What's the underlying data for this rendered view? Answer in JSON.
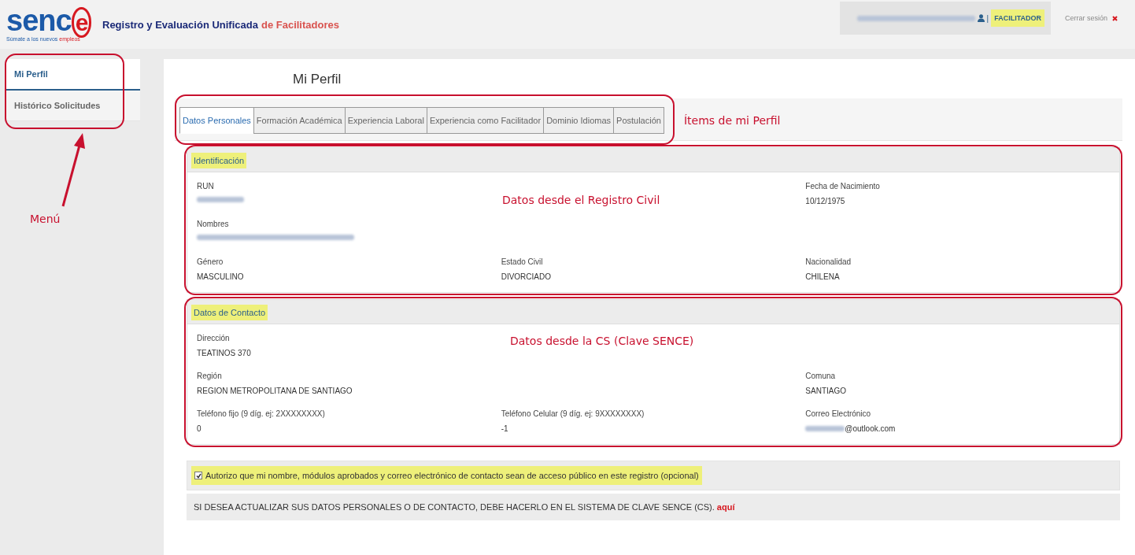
{
  "header": {
    "logo": {
      "wordmark": "senc",
      "wordmark_end": "e",
      "tagline": "Súmate a los nuevos",
      "tagline_accent": "empleos"
    },
    "title": "Registro y Evaluación Unificada",
    "title_accent": "de Facilitadores",
    "user": {
      "separator": "|",
      "role": "FACILITADOR",
      "highlighted": true
    },
    "logout": "Cerrar sesión"
  },
  "sidebar": {
    "outlined": true,
    "annotation": "Menú",
    "items": [
      {
        "label": "Mi Perfil",
        "selected": true
      },
      {
        "label": "Histórico Solicitudes",
        "selected": false
      }
    ]
  },
  "page_title": "Mi Perfil",
  "tabs": {
    "outlined": true,
    "annotation": "Ítems de mi Perfil",
    "items": [
      {
        "label": "Datos Personales",
        "selected": true
      },
      {
        "label": "Formación Académica",
        "selected": false
      },
      {
        "label": "Experiencia Laboral",
        "selected": false
      },
      {
        "label": "Experiencia como Facilitador",
        "selected": false
      },
      {
        "label": "Dominio Idiomas",
        "selected": false
      },
      {
        "label": "Postulación",
        "selected": false
      }
    ]
  },
  "sections": [
    {
      "kind": "identification",
      "title": "Identificación",
      "highlighted": true,
      "outlined": true,
      "annotation": "Datos desde el Registro Civil",
      "fields": [
        {
          "label": "RUN",
          "blurred": true
        },
        {
          "label": "Fecha de Nacimiento",
          "value": "10/12/1975",
          "blurred": false
        },
        {
          "label": "Nombres",
          "blurred": true
        },
        {
          "label": "Género",
          "value": "MASCULINO",
          "blurred": false
        },
        {
          "label": "Estado Civil",
          "value": "DIVORCIADO",
          "blurred": false
        },
        {
          "label": "Nacionalidad",
          "value": "CHILENA",
          "blurred": false
        }
      ]
    },
    {
      "kind": "contact",
      "title": "Datos de Contacto",
      "highlighted": true,
      "outlined": true,
      "annotation": "Datos desde la CS (Clave SENCE)",
      "fields": [
        {
          "label": "Dirección",
          "value": "TEATINOS 370",
          "blurred": false
        },
        {
          "label": "Región",
          "value": "REGION METROPOLITANA DE SANTIAGO",
          "blurred": false
        },
        {
          "label": "Comuna",
          "value": "SANTIAGO",
          "blurred": false
        },
        {
          "label": "Teléfono fijo (9 díg. ej: 2XXXXXXXX)",
          "value": "0",
          "blurred": false
        },
        {
          "label": "Teléfono Celular (9 díg. ej: 9XXXXXXXX)",
          "value": "-1",
          "blurred": false
        },
        {
          "label": "Correo Electrónico",
          "value": "@outlook.com",
          "blurred": true
        }
      ]
    }
  ],
  "consent": {
    "checked": true,
    "highlighted": true,
    "text": "Autorizo que mi nombre, módulos aprobados y correo electrónico de contacto sean de acceso público en este registro (opcional)"
  },
  "notice": {
    "text": "SI DESEA ACTUALIZAR SUS DATOS PERSONALES O DE CONTACTO, DEBE HACERLO EN EL SISTEMA DE CLAVE SENCE (CS).",
    "link": "aquí"
  }
}
